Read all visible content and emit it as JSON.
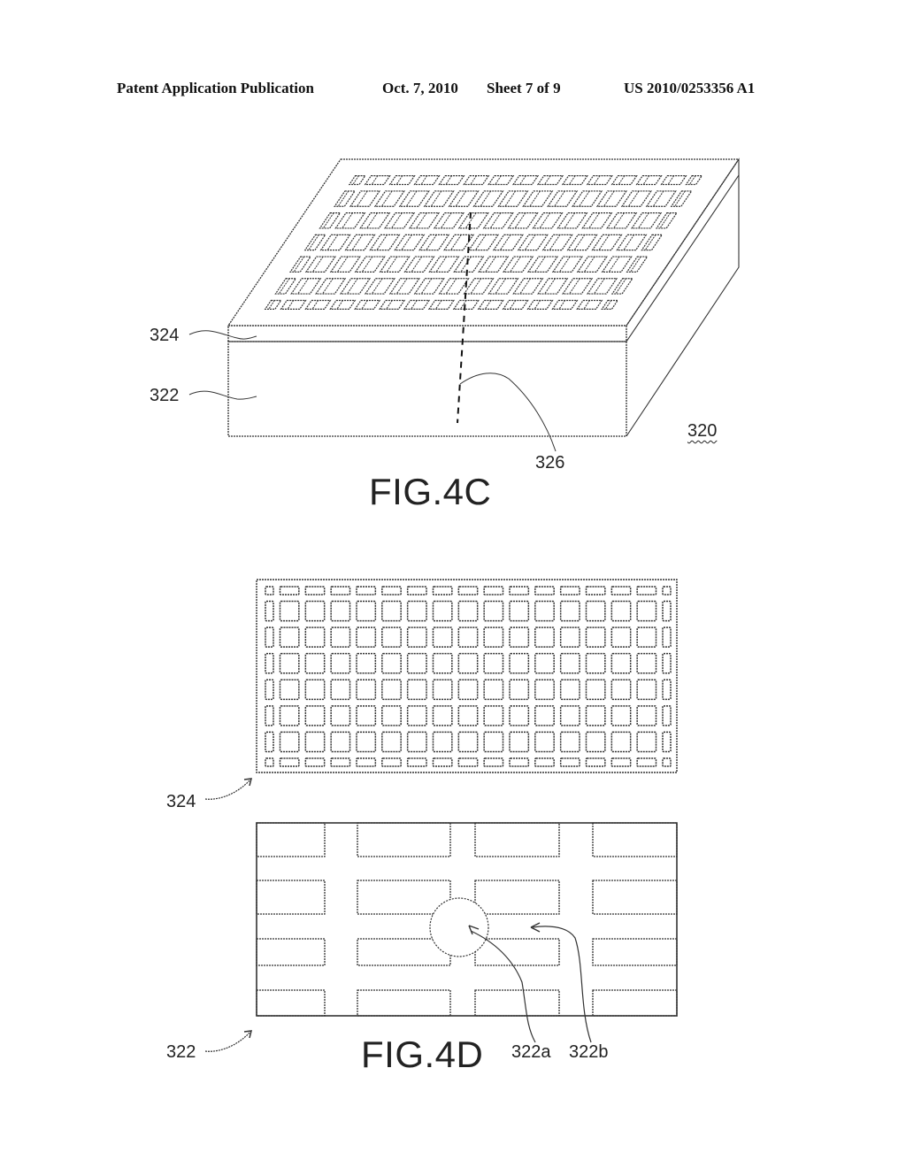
{
  "header": {
    "publication": "Patent Application Publication",
    "date": "Oct. 7, 2010",
    "sheet": "Sheet 7 of 9",
    "number": "US 2010/0253356 A1"
  },
  "fig4c": {
    "caption": "FIG.4C",
    "labels": {
      "top_layer": "324",
      "substrate": "322",
      "cut_line": "326",
      "assembly": "320"
    },
    "grid": {
      "rows": 7,
      "cols": 15
    }
  },
  "fig4d": {
    "caption": "FIG.4D",
    "labels": {
      "mesh_layer": "324",
      "patterned_layer": "322",
      "region_a": "322a",
      "region_b": "322b"
    },
    "mesh_grid": {
      "rows": 8,
      "cols": 17
    },
    "block_pattern": {
      "rows": 4,
      "cols": 4
    }
  },
  "colors": {
    "line": "#333333",
    "text": "#222222",
    "background": "#ffffff"
  }
}
